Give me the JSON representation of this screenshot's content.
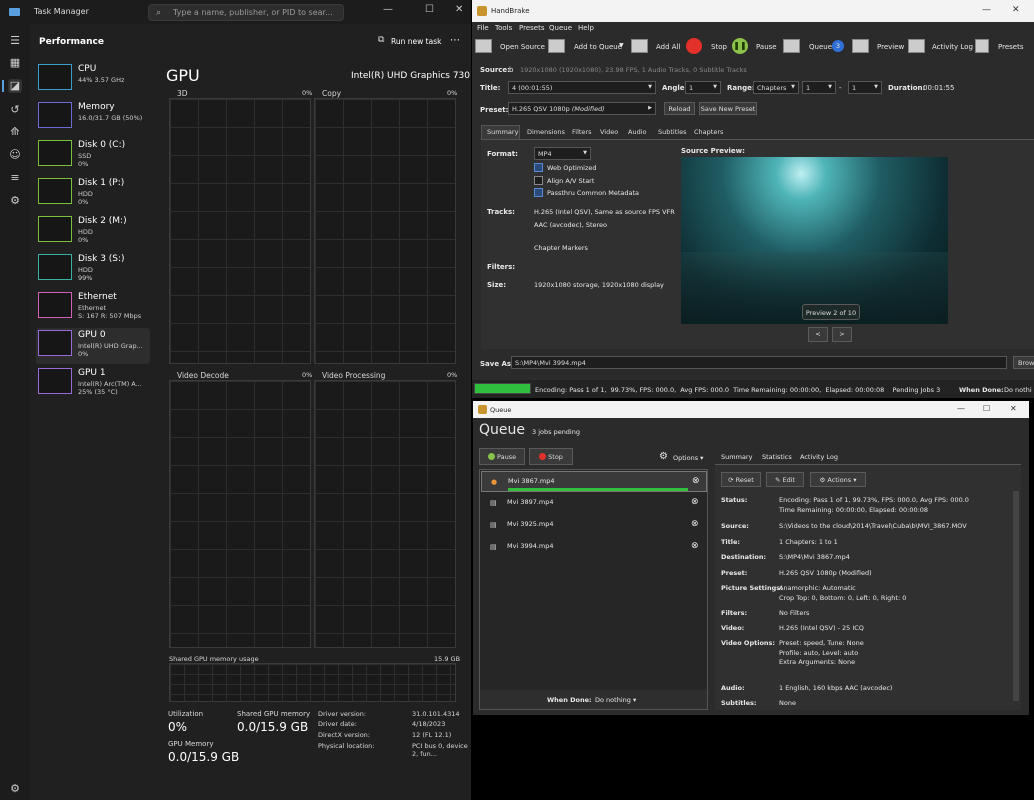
{
  "taskmanager": {
    "title": "Task Manager",
    "search_placeholder": "Type a name, publisher, or PID to sear...",
    "section": "Performance",
    "run_new_task": "Run new task",
    "more": "⋯",
    "devices": [
      {
        "name": "CPU",
        "s1": "44% 3.57 GHz",
        "s2": "",
        "color": "#3aa0c8"
      },
      {
        "name": "Memory",
        "s1": "16.0/31.7 GB (50%)",
        "s2": "",
        "color": "#6b6bd6"
      },
      {
        "name": "Disk 0 (C:)",
        "s1": "SSD",
        "s2": "0%",
        "color": "#7bbf3a"
      },
      {
        "name": "Disk 1 (P:)",
        "s1": "HDD",
        "s2": "0%",
        "color": "#7bbf3a"
      },
      {
        "name": "Disk 2 (M:)",
        "s1": "HDD",
        "s2": "0%",
        "color": "#7bbf3a"
      },
      {
        "name": "Disk 3 (S:)",
        "s1": "HDD",
        "s2": "99%",
        "color": "#3ab0a0"
      },
      {
        "name": "Ethernet",
        "s1": "Ethernet",
        "s2": "S: 167 R: 507 Mbps",
        "color": "#d060b8"
      },
      {
        "name": "GPU 0",
        "s1": "Intel(R) UHD Grap...",
        "s2": "0%",
        "color": "#9a6ad8"
      },
      {
        "name": "GPU 1",
        "s1": "Intel(R) Arc(TM) A...",
        "s2": "25% (35 °C)",
        "color": "#9a6ad8"
      }
    ],
    "gpu": {
      "heading": "GPU",
      "model": "Intel(R) UHD Graphics 730",
      "g3d": "3D",
      "g3d_pct": "0%",
      "copy": "Copy",
      "copy_pct": "0%",
      "vdec": "Video Decode",
      "vdec_pct": "0%",
      "vproc": "Video Processing",
      "vproc_pct": "0%",
      "shared_label": "Shared GPU memory usage",
      "shared_max": "15.9 GB",
      "util_label": "Utilization",
      "util_val": "0%",
      "sgm_label": "Shared GPU memory",
      "sgm_val": "0.0/15.9 GB",
      "gm_label": "GPU Memory",
      "gm_val": "0.0/15.9 GB",
      "driver_version_label": "Driver version:",
      "driver_version": "31.0.101.4314",
      "driver_date_label": "Driver date:",
      "driver_date": "4/18/2023",
      "directx_label": "DirectX version:",
      "directx": "12 (FL 12.1)",
      "location_label": "Physical location:",
      "location": "PCI bus 0, device 2, fun..."
    }
  },
  "handbrake": {
    "title": "HandBrake",
    "menu": [
      "File",
      "Tools",
      "Presets",
      "Queue",
      "Help"
    ],
    "toolbar": {
      "open_source": "Open Source",
      "add_to_queue": "Add to Queue",
      "add_all": "Add All",
      "stop": "Stop",
      "pause": "Pause",
      "queue": "Queue",
      "queue_count": "3",
      "preview": "Preview",
      "activity_log": "Activity Log",
      "presets": "Presets"
    },
    "source_label": "Source:",
    "source_value": "b",
    "source_info": "1920x1080 (1920x1080), 23.98 FPS, 1 Audio Tracks, 0 Subtitle Tracks",
    "title_label": "Title:",
    "title_value": "4 (00:01:55)",
    "angle_label": "Angle:",
    "angle_value": "1",
    "range_label": "Range:",
    "range_value": "Chapters",
    "range_from": "1",
    "range_dash": "-",
    "range_to": "1",
    "duration_label": "Duration:",
    "duration_value": "00:01:55",
    "preset_label": "Preset:",
    "preset_value": "H.265 QSV 1080p",
    "preset_modified": "(Modified)",
    "reload": "Reload",
    "save_new_preset": "Save New Preset",
    "tabs": [
      "Summary",
      "Dimensions",
      "Filters",
      "Video",
      "Audio",
      "Subtitles",
      "Chapters"
    ],
    "format_label": "Format:",
    "format_value": "MP4",
    "opt_web": "Web Optimized",
    "opt_align": "Align A/V Start",
    "opt_passthru": "Passthru Common Metadata",
    "tracks_label": "Tracks:",
    "tracks_1": "H.265 (Intel QSV), Same as source FPS VFR",
    "tracks_2": "AAC (avcodec), Stereo",
    "tracks_3": "Chapter Markers",
    "filters_label": "Filters:",
    "size_label": "Size:",
    "size_value": "1920x1080 storage, 1920x1080 display",
    "preview_label": "Source Preview:",
    "preview_badge": "Preview 2 of 10",
    "prev": "<",
    "next": ">",
    "saveas_label": "Save As:",
    "saveas_value": "S:\\MP4\\Mvi 3994.mp4",
    "browse": "Brow",
    "status": "Encoding: Pass 1 of 1,  99.73%, FPS: 000.0,  Avg FPS: 000.0  Time Remaining: 00:00:00,  Elapsed: 00:00:08    Pending Jobs 3",
    "progress": 0.9973,
    "when_done_label": "When Done:",
    "when_done_value": "Do nothi"
  },
  "queue": {
    "title": "Queue",
    "heading": "Queue",
    "pending": "3 jobs pending",
    "pause": "Pause",
    "stop": "Stop",
    "options": "Options",
    "items": [
      {
        "name": "Mvi 3867.mp4",
        "active": true
      },
      {
        "name": "Mvi 3897.mp4",
        "active": false
      },
      {
        "name": "Mvi 3925.mp4",
        "active": false
      },
      {
        "name": "Mvi 3994.mp4",
        "active": false
      }
    ],
    "active_progress": 0.9973,
    "when_done_label": "When Done:",
    "when_done_value": "Do nothing",
    "tabs": [
      "Summary",
      "Statistics",
      "Activity Log"
    ],
    "reset": "Reset",
    "edit": "Edit",
    "actions": "Actions",
    "details": [
      {
        "k": "Status:",
        "v": [
          "Encoding: Pass 1 of 1,  99.73%, FPS: 000.0,  Avg FPS: 000.0",
          "Time Remaining: 00:00:00,  Elapsed: 00:00:08"
        ]
      },
      {
        "k": "Source:",
        "v": [
          "S:\\Videos to the cloud\\2014\\Travel\\Cuba\\b\\MVI_3867.MOV"
        ]
      },
      {
        "k": "Title:",
        "v": [
          "1   Chapters: 1 to 1"
        ]
      },
      {
        "k": "Destination:",
        "v": [
          "S:\\MP4\\Mvi 3867.mp4"
        ]
      },
      {
        "k": "Preset:",
        "v": [
          "H.265 QSV 1080p (Modified)"
        ]
      },
      {
        "k": "Picture Settings:",
        "v": [
          "Anamorphic: Automatic",
          "Crop Top: 0, Bottom: 0, Left: 0, Right: 0"
        ]
      },
      {
        "k": "Filters:",
        "v": [
          "No Filters"
        ]
      },
      {
        "k": "Video:",
        "v": [
          "H.265 (Intel QSV) - 25 ICQ"
        ]
      },
      {
        "k": "Video Options:",
        "v": [
          "Preset: speed, Tune: None",
          "Profile: auto, Level: auto",
          "Extra Arguments: None"
        ]
      },
      {
        "k": "Audio:",
        "v": [
          "1 English, 160 kbps AAC (avcodec)"
        ]
      },
      {
        "k": "Subtitles:",
        "v": [
          "None"
        ]
      }
    ]
  }
}
